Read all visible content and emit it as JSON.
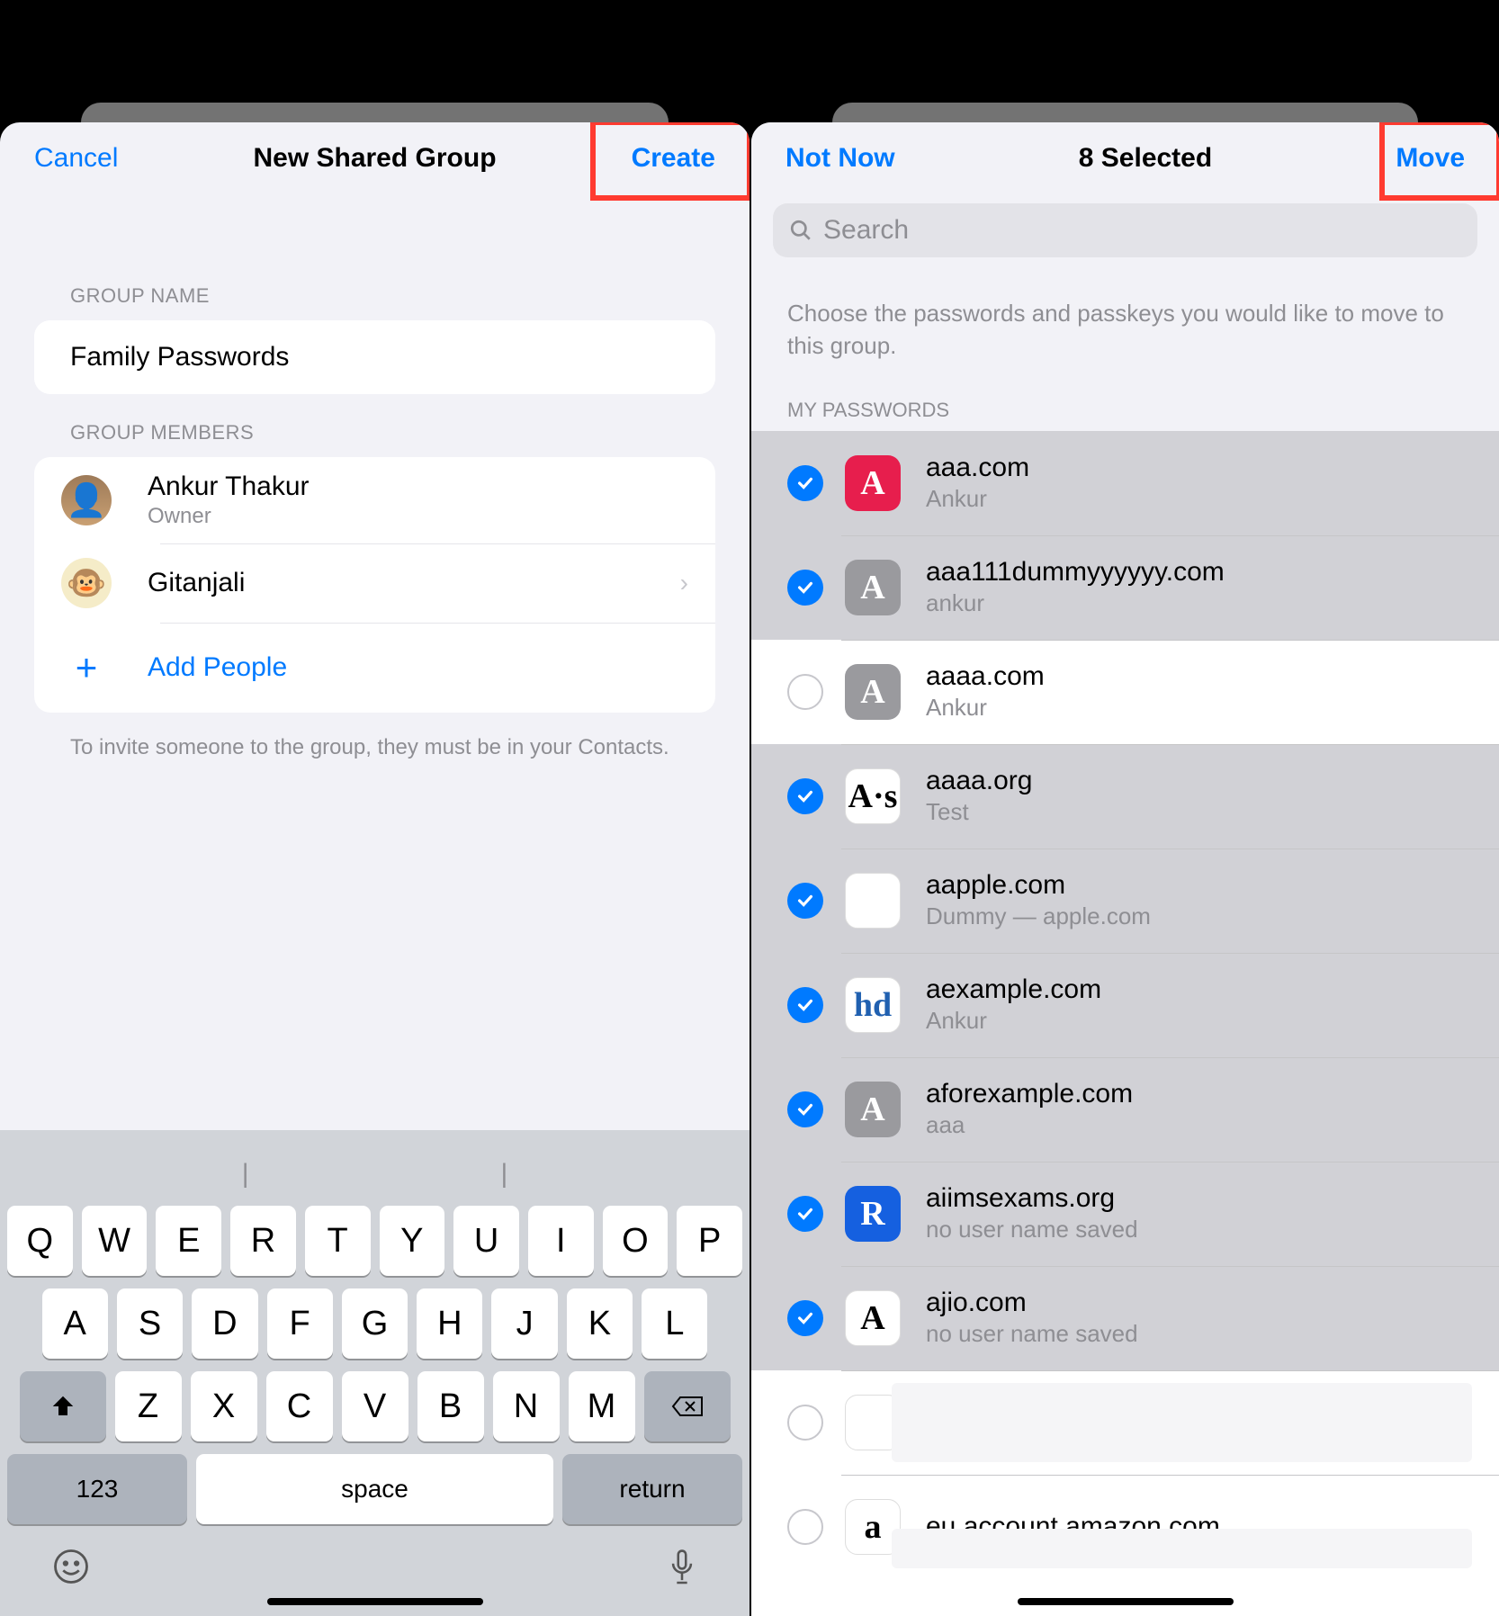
{
  "left": {
    "nav": {
      "cancel": "Cancel",
      "title": "New Shared Group",
      "create": "Create"
    },
    "group_name_label": "GROUP NAME",
    "group_name_value": "Family Passwords",
    "members_label": "GROUP MEMBERS",
    "members": [
      {
        "name": "Ankur Thakur",
        "sub": "Owner",
        "avatar": "photo",
        "chevron": false
      },
      {
        "name": "Gitanjali",
        "sub": "",
        "avatar": "monkey",
        "chevron": true
      }
    ],
    "add_people": "Add People",
    "footnote": "To invite someone to the group, they must be in your Contacts.",
    "keyboard": {
      "row1": [
        "Q",
        "W",
        "E",
        "R",
        "T",
        "Y",
        "U",
        "I",
        "O",
        "P"
      ],
      "row2": [
        "A",
        "S",
        "D",
        "F",
        "G",
        "H",
        "J",
        "K",
        "L"
      ],
      "row3": [
        "Z",
        "X",
        "C",
        "V",
        "B",
        "N",
        "M"
      ],
      "num": "123",
      "space": "space",
      "return": "return"
    }
  },
  "right": {
    "nav": {
      "not_now": "Not Now",
      "title": "8 Selected",
      "move": "Move"
    },
    "search_placeholder": "Search",
    "instruction": "Choose the passwords and passkeys you would like to move to this group.",
    "list_header": "MY PASSWORDS",
    "rows": [
      {
        "site": "aaa.com",
        "user": "Ankur",
        "selected": true,
        "icon_bg": "#e71e4d",
        "icon_text": "A"
      },
      {
        "site": "aaa111dummyyyyyy.com",
        "user": "ankur",
        "selected": true,
        "icon_bg": "#9a9a9e",
        "icon_text": "A"
      },
      {
        "site": "aaaa.com",
        "user": "Ankur",
        "selected": false,
        "icon_bg": "#9a9a9e",
        "icon_text": "A"
      },
      {
        "site": "aaaa.org",
        "user": "Test",
        "selected": true,
        "icon_bg": "#ffffff",
        "icon_text": "A·s",
        "icon_fg": "#000"
      },
      {
        "site": "aapple.com",
        "user": "Dummy — apple.com",
        "selected": true,
        "icon_bg": "#ffffff",
        "icon_text": "",
        "icon_fg": "#555"
      },
      {
        "site": "aexample.com",
        "user": "Ankur",
        "selected": true,
        "icon_bg": "#ffffff",
        "icon_text": "hd",
        "icon_fg": "#2060b0"
      },
      {
        "site": "aforexample.com",
        "user": "aaa",
        "selected": true,
        "icon_bg": "#9a9a9e",
        "icon_text": "A"
      },
      {
        "site": "aiimsexams.org",
        "user": "no user name saved",
        "selected": true,
        "icon_bg": "#1560e0",
        "icon_text": "R"
      },
      {
        "site": "ajio.com",
        "user": "no user name saved",
        "selected": true,
        "icon_bg": "#ffffff",
        "icon_text": "A",
        "icon_fg": "#000"
      },
      {
        "site": "",
        "user": "",
        "selected": false,
        "masked": true,
        "icon_bg": "#ffffff",
        "icon_text": ""
      },
      {
        "site": "eu.account.amazon.com",
        "user": "",
        "selected": false,
        "icon_bg": "#ffffff",
        "icon_text": "a",
        "icon_fg": "#000",
        "partial_mask": true
      }
    ]
  }
}
